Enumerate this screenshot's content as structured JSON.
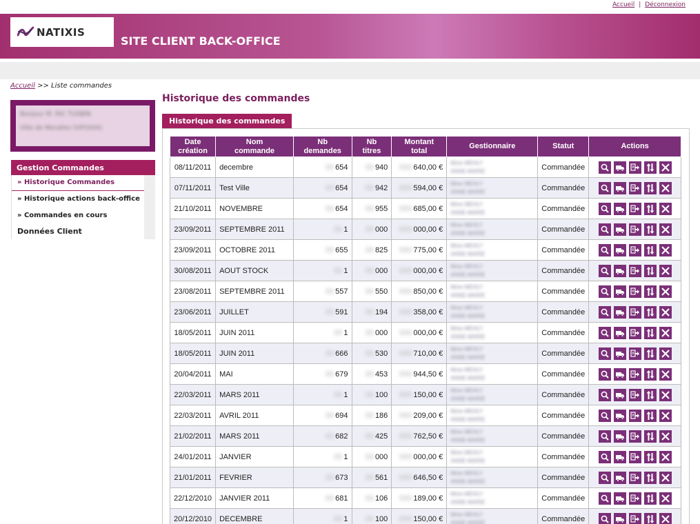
{
  "toplinks": {
    "home": "Accueil",
    "separator": "|",
    "logout": "Déconnexion"
  },
  "brand": {
    "logo": "NATIXIS",
    "site_title": "SITE CLIENT BACK-OFFICE"
  },
  "breadcrumb": {
    "home": "Accueil",
    "separator": ">>",
    "current": "Liste commandes"
  },
  "client": {
    "line1": "Bonjour M. RIC TUSBIN",
    "line2": "Ville de Moralles (VIFOVIA)"
  },
  "menu": {
    "section": "Gestion Commandes",
    "items": [
      {
        "label": "» Historique Commandes"
      },
      {
        "label": "» Historique actions back-office"
      },
      {
        "label": "» Commandes en cours"
      }
    ],
    "section2": "Données Client"
  },
  "main": {
    "title": "Historique des commandes",
    "tab": "Historique des commandes"
  },
  "table": {
    "headers": {
      "date": [
        "Date",
        "création"
      ],
      "name": [
        "Nom",
        "commande"
      ],
      "requests": [
        "Nb",
        "demandes"
      ],
      "titles": [
        "Nb",
        "titres"
      ],
      "amount": [
        "Montant",
        "total"
      ],
      "manager": "Gestionnaire",
      "status": "Statut",
      "actions": "Actions"
    },
    "rows": [
      {
        "date": "08/11/2011",
        "name": "decembre",
        "requests": "654",
        "titles": "940",
        "amount": "640,00 €",
        "manager_l1": "Mme MEHLY",
        "manager_l2": "ANNE-MARIE",
        "status": "Commandée"
      },
      {
        "date": "07/11/2011",
        "name": "Test Ville",
        "requests": "654",
        "titles": "942",
        "amount": "594,00 €",
        "manager_l1": "Mme MEHLY",
        "manager_l2": "ANNE-MARIE",
        "status": "Commandée"
      },
      {
        "date": "21/10/2011",
        "name": "NOVEMBRE",
        "requests": "654",
        "titles": "955",
        "amount": "685,00 €",
        "manager_l1": "Mme MEHLY",
        "manager_l2": "ANNE-MARIE",
        "status": "Commandée"
      },
      {
        "date": "23/09/2011",
        "name": "SEPTEMBRE 2011",
        "requests": "1",
        "titles": "000",
        "amount": "000,00 €",
        "manager_l1": "Mme MEHLY",
        "manager_l2": "ANNE-MARIE",
        "status": "Commandée"
      },
      {
        "date": "23/09/2011",
        "name": "OCTOBRE 2011",
        "requests": "655",
        "titles": "825",
        "amount": "775,00 €",
        "manager_l1": "Mme MEHLY",
        "manager_l2": "ANNE-MARIE",
        "status": "Commandée"
      },
      {
        "date": "30/08/2011",
        "name": "AOUT STOCK",
        "requests": "1",
        "titles": "000",
        "amount": "000,00 €",
        "manager_l1": "Mme MEHLY",
        "manager_l2": "ANNE-MARIE",
        "status": "Commandée"
      },
      {
        "date": "23/08/2011",
        "name": "SEPTEMBRE 2011",
        "requests": "557",
        "titles": "550",
        "amount": "850,00 €",
        "manager_l1": "Mme MEHLY",
        "manager_l2": "ANNE-MARIE",
        "status": "Commandée"
      },
      {
        "date": "23/06/2011",
        "name": "JUILLET",
        "requests": "591",
        "titles": "194",
        "amount": "358,00 €",
        "manager_l1": "Mme MEHLY",
        "manager_l2": "ANNE-MARIE",
        "status": "Commandée"
      },
      {
        "date": "18/05/2011",
        "name": "JUIN 2011",
        "requests": "1",
        "titles": "000",
        "amount": "000,00 €",
        "manager_l1": "Mme MEHLY",
        "manager_l2": "ANNE-MARIE",
        "status": "Commandée"
      },
      {
        "date": "18/05/2011",
        "name": "JUIN 2011",
        "requests": "666",
        "titles": "530",
        "amount": "710,00 €",
        "manager_l1": "Mme MEHLY",
        "manager_l2": "ANNE-MARIE",
        "status": "Commandée"
      },
      {
        "date": "20/04/2011",
        "name": "MAI",
        "requests": "679",
        "titles": "453",
        "amount": "944,50 €",
        "manager_l1": "Mme MEHLY",
        "manager_l2": "ANNE-MARIE",
        "status": "Commandée"
      },
      {
        "date": "22/03/2011",
        "name": "MARS 2011",
        "requests": "1",
        "titles": "100",
        "amount": "150,00 €",
        "manager_l1": "Mme MEHLY",
        "manager_l2": "ANNE-MARIE",
        "status": "Commandée"
      },
      {
        "date": "22/03/2011",
        "name": "AVRIL 2011",
        "requests": "694",
        "titles": "186",
        "amount": "209,00 €",
        "manager_l1": "Mme MEHLY",
        "manager_l2": "ANNE-MARIE",
        "status": "Commandée"
      },
      {
        "date": "21/02/2011",
        "name": "MARS 2011",
        "requests": "682",
        "titles": "425",
        "amount": "762,50 €",
        "manager_l1": "Mme MEHLY",
        "manager_l2": "ANNE-MARIE",
        "status": "Commandée"
      },
      {
        "date": "24/01/2011",
        "name": "JANVIER",
        "requests": "1",
        "titles": "000",
        "amount": "000,00 €",
        "manager_l1": "Mme MEHLY",
        "manager_l2": "ANNE-MARIE",
        "status": "Commandée"
      },
      {
        "date": "21/01/2011",
        "name": "FEVRIER",
        "requests": "673",
        "titles": "561",
        "amount": "646,50 €",
        "manager_l1": "Mme MEHLY",
        "manager_l2": "ANNE-MARIE",
        "status": "Commandée"
      },
      {
        "date": "22/12/2010",
        "name": "JANVIER 2011",
        "requests": "681",
        "titles": "106",
        "amount": "189,00 €",
        "manager_l1": "Mme MEHLY",
        "manager_l2": "ANNE-MARIE",
        "status": "Commandée"
      },
      {
        "date": "20/12/2010",
        "name": "DECEMBRE",
        "requests": "1",
        "titles": "100",
        "amount": "150,00 €",
        "manager_l1": "Mme MEHLY",
        "manager_l2": "ANNE-MARIE",
        "status": "Commandée"
      }
    ],
    "action_icons": [
      "magnifier-icon",
      "truck-icon",
      "transfer-icon",
      "sort-arrows-icon",
      "close-icon"
    ]
  },
  "colors": {
    "brand": "#a31f5d",
    "header": "#7b2f78",
    "row_alt": "#eeeef6"
  }
}
